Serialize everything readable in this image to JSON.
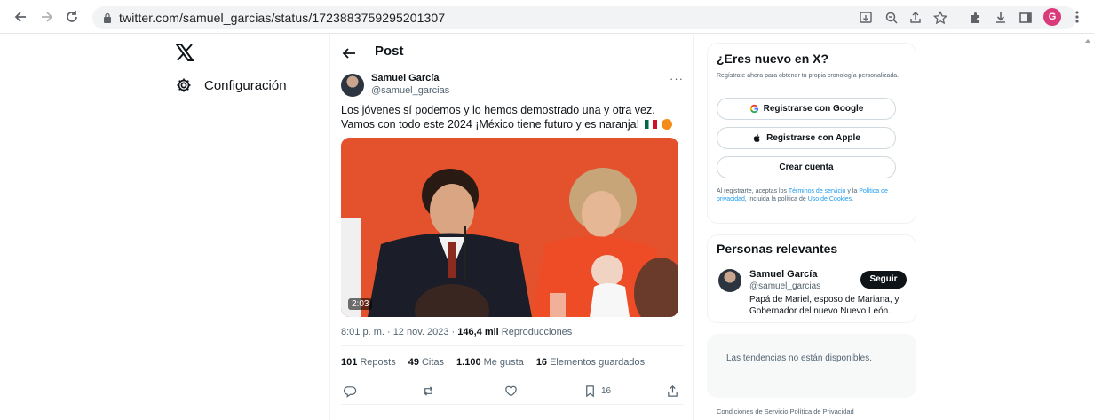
{
  "browser": {
    "url": "twitter.com/samuel_garcias/status/1723883759295201307",
    "profile_initial": "G"
  },
  "sidebar": {
    "settings_label": "Configuración"
  },
  "post": {
    "header_title": "Post",
    "author_name": "Samuel García",
    "author_handle": "@samuel_garcias",
    "more_label": "···",
    "text": "Los jóvenes sí podemos y lo hemos demostrado una y otra vez. Vamos con todo este 2024 ¡México tiene futuro y es naranja!",
    "video_duration": "2:03",
    "time_date": "8:01 p. m. · 12 nov. 2023 · ",
    "views_count": "146,4 mil",
    "views_label": " Reproducciones",
    "stats": [
      {
        "count": "101",
        "label": "Reposts"
      },
      {
        "count": "49",
        "label": "Citas"
      },
      {
        "count": "1.100",
        "label": "Me gusta"
      },
      {
        "count": "16",
        "label": "Elementos guardados"
      }
    ],
    "bookmark_count": "16"
  },
  "signup": {
    "title": "¿Eres nuevo en X?",
    "subtitle": "Regístrate ahora para obtener tu propia cronología personalizada.",
    "google_label": "Registrarse con Google",
    "apple_label": "Registrarse con Apple",
    "create_label": "Crear cuenta",
    "legal_prefix": "Al registrarte, aceptas los ",
    "terms_link": "Términos de servicio",
    "legal_mid": " y la ",
    "privacy_link": "Política de privacidad",
    "legal_mid2": ", incluida la política de ",
    "cookies_link": "Uso de Cookies",
    "legal_end": "."
  },
  "relevant": {
    "title": "Personas relevantes",
    "name": "Samuel García",
    "handle": "@samuel_garcias",
    "bio": "Papá de Mariel, esposo de Mariana, y Gobernador del nuevo Nuevo León.",
    "follow_label": "Seguir"
  },
  "trends": {
    "message": "Las tendencias no están disponibles."
  },
  "footer": {
    "links": "Condiciones de Servicio   Política de Privacidad"
  }
}
